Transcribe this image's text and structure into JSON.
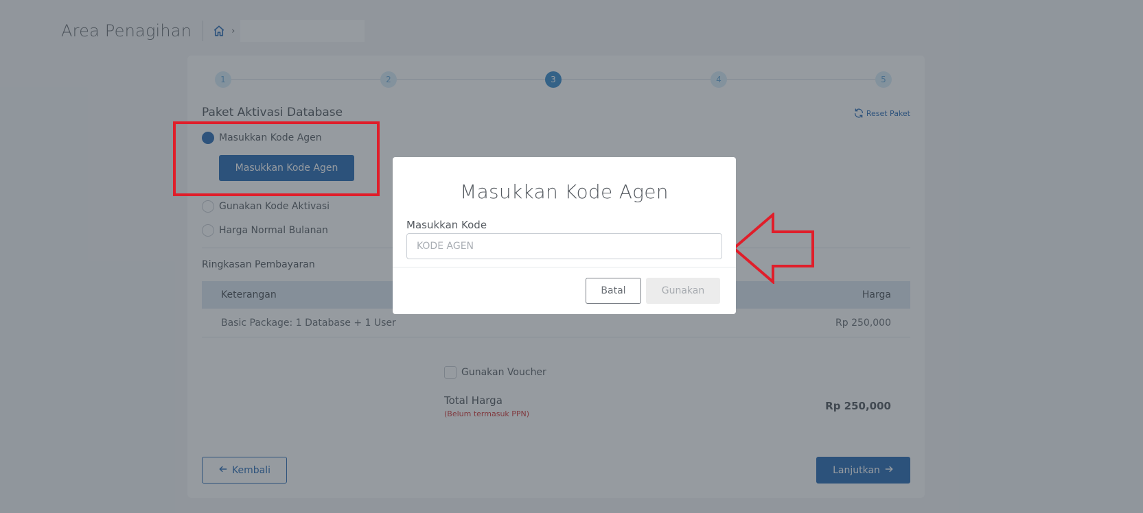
{
  "header": {
    "title": "Area Penagihan",
    "home_icon": "home-icon",
    "breadcrumb_chevron": "›"
  },
  "stepper": {
    "steps": [
      "1",
      "2",
      "3",
      "4",
      "5"
    ],
    "active_step": 3
  },
  "package": {
    "title": "Paket Aktivasi Database",
    "reset_label": "Reset Paket",
    "options": [
      {
        "label": "Masukkan Kode Agen",
        "selected": true
      },
      {
        "label": "Gunakan Kode Aktivasi",
        "selected": false
      },
      {
        "label": "Harga Normal Bulanan",
        "selected": false
      }
    ],
    "agent_button_label": "Masukkan Kode Agen"
  },
  "summary": {
    "title": "Ringkasan Pembayaran",
    "columns": [
      "Keterangan",
      "Harga"
    ],
    "rows": [
      {
        "description": "Basic Package: 1 Database + 1 User",
        "price": "Rp 250,000"
      }
    ],
    "voucher_label": "Gunakan Voucher",
    "total_label": "Total Harga",
    "total_note": "(Belum termasuk PPN)",
    "total_value": "Rp 250,000"
  },
  "footer": {
    "back_label": "Kembali",
    "next_label": "Lanjutkan"
  },
  "modal": {
    "title": "Masukkan Kode Agen",
    "field_label": "Masukkan Kode",
    "input_placeholder": "KODE AGEN",
    "input_value": "",
    "cancel_label": "Batal",
    "apply_label": "Gunakan"
  },
  "colors": {
    "primary": "#2b6cb5",
    "annotation_red": "#e01e2a",
    "note_red": "#d23b3b"
  }
}
